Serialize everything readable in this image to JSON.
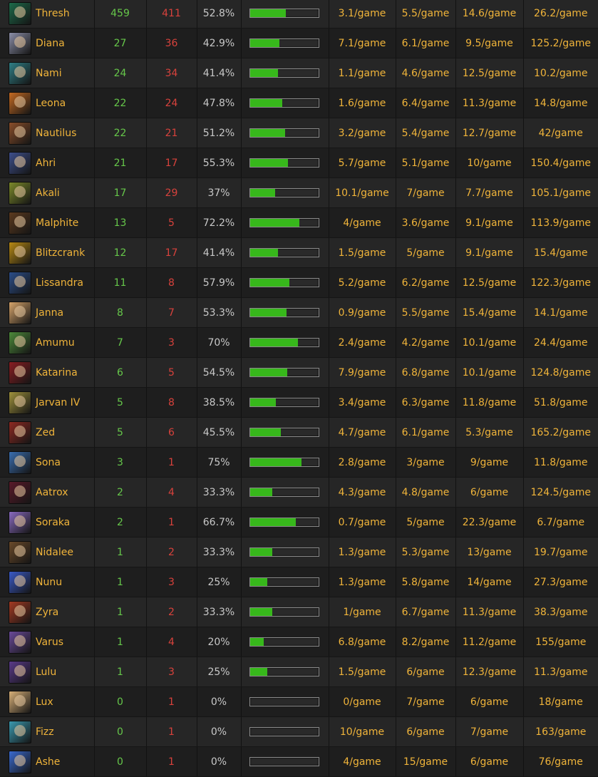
{
  "colors": {
    "champion_name": "#f0b43a",
    "wins": "#66c74a",
    "losses": "#d8423c",
    "win_rate": "#c8c8c8",
    "stats": "#f0b43a",
    "bar_fill": "#37b81b"
  },
  "rows": [
    {
      "name": "Thresh",
      "icon": "thresh-portrait-icon",
      "tint": "#1d6b4a",
      "wins": "459",
      "losses": "411",
      "win_rate": "52.8%",
      "win_fraction": 0.528,
      "s1": "3.1/game",
      "s2": "5.5/game",
      "s3": "14.6/game",
      "s4": "26.2/game"
    },
    {
      "name": "Diana",
      "icon": "diana-portrait-icon",
      "tint": "#8c8fa8",
      "wins": "27",
      "losses": "36",
      "win_rate": "42.9%",
      "win_fraction": 0.429,
      "s1": "7.1/game",
      "s2": "6.1/game",
      "s3": "9.5/game",
      "s4": "125.2/game"
    },
    {
      "name": "Nami",
      "icon": "nami-portrait-icon",
      "tint": "#2f7f86",
      "wins": "24",
      "losses": "34",
      "win_rate": "41.4%",
      "win_fraction": 0.414,
      "s1": "1.1/game",
      "s2": "4.6/game",
      "s3": "12.5/game",
      "s4": "10.2/game"
    },
    {
      "name": "Leona",
      "icon": "leona-portrait-icon",
      "tint": "#c46a22",
      "wins": "22",
      "losses": "24",
      "win_rate": "47.8%",
      "win_fraction": 0.478,
      "s1": "1.6/game",
      "s2": "6.4/game",
      "s3": "11.3/game",
      "s4": "14.8/game"
    },
    {
      "name": "Nautilus",
      "icon": "nautilus-portrait-icon",
      "tint": "#8a4e2a",
      "wins": "22",
      "losses": "21",
      "win_rate": "51.2%",
      "win_fraction": 0.512,
      "s1": "3.2/game",
      "s2": "5.4/game",
      "s3": "12.7/game",
      "s4": "42/game"
    },
    {
      "name": "Ahri",
      "icon": "ahri-portrait-icon",
      "tint": "#3e4f8c",
      "wins": "21",
      "losses": "17",
      "win_rate": "55.3%",
      "win_fraction": 0.553,
      "s1": "5.7/game",
      "s2": "5.1/game",
      "s3": "10/game",
      "s4": "150.4/game"
    },
    {
      "name": "Akali",
      "icon": "akali-portrait-icon",
      "tint": "#7c8a2a",
      "wins": "17",
      "losses": "29",
      "win_rate": "37%",
      "win_fraction": 0.37,
      "s1": "10.1/game",
      "s2": "7/game",
      "s3": "7.7/game",
      "s4": "105.1/game"
    },
    {
      "name": "Malphite",
      "icon": "malphite-portrait-icon",
      "tint": "#5c3a1e",
      "wins": "13",
      "losses": "5",
      "win_rate": "72.2%",
      "win_fraction": 0.722,
      "s1": "4/game",
      "s2": "3.6/game",
      "s3": "9.1/game",
      "s4": "113.9/game"
    },
    {
      "name": "Blitzcrank",
      "icon": "blitzcrank-portrait-icon",
      "tint": "#b88a14",
      "wins": "12",
      "losses": "17",
      "win_rate": "41.4%",
      "win_fraction": 0.414,
      "s1": "1.5/game",
      "s2": "5/game",
      "s3": "9.1/game",
      "s4": "15.4/game"
    },
    {
      "name": "Lissandra",
      "icon": "lissandra-portrait-icon",
      "tint": "#2c4e8a",
      "wins": "11",
      "losses": "8",
      "win_rate": "57.9%",
      "win_fraction": 0.579,
      "s1": "5.2/game",
      "s2": "6.2/game",
      "s3": "12.5/game",
      "s4": "122.3/game"
    },
    {
      "name": "Janna",
      "icon": "janna-portrait-icon",
      "tint": "#d6a46a",
      "wins": "8",
      "losses": "7",
      "win_rate": "53.3%",
      "win_fraction": 0.533,
      "s1": "0.9/game",
      "s2": "5.5/game",
      "s3": "15.4/game",
      "s4": "14.1/game"
    },
    {
      "name": "Amumu",
      "icon": "amumu-portrait-icon",
      "tint": "#4d8a3a",
      "wins": "7",
      "losses": "3",
      "win_rate": "70%",
      "win_fraction": 0.7,
      "s1": "2.4/game",
      "s2": "4.2/game",
      "s3": "10.1/game",
      "s4": "24.4/game"
    },
    {
      "name": "Katarina",
      "icon": "katarina-portrait-icon",
      "tint": "#8a1e22",
      "wins": "6",
      "losses": "5",
      "win_rate": "54.5%",
      "win_fraction": 0.545,
      "s1": "7.9/game",
      "s2": "6.8/game",
      "s3": "10.1/game",
      "s4": "124.8/game"
    },
    {
      "name": "Jarvan IV",
      "icon": "jarvan-iv-portrait-icon",
      "tint": "#a0923c",
      "wins": "5",
      "losses": "8",
      "win_rate": "38.5%",
      "win_fraction": 0.385,
      "s1": "3.4/game",
      "s2": "6.3/game",
      "s3": "11.8/game",
      "s4": "51.8/game"
    },
    {
      "name": "Zed",
      "icon": "zed-portrait-icon",
      "tint": "#8e2a22",
      "wins": "5",
      "losses": "6",
      "win_rate": "45.5%",
      "win_fraction": 0.455,
      "s1": "4.7/game",
      "s2": "6.1/game",
      "s3": "5.3/game",
      "s4": "165.2/game"
    },
    {
      "name": "Sona",
      "icon": "sona-portrait-icon",
      "tint": "#3a6eb0",
      "wins": "3",
      "losses": "1",
      "win_rate": "75%",
      "win_fraction": 0.75,
      "s1": "2.8/game",
      "s2": "3/game",
      "s3": "9/game",
      "s4": "11.8/game"
    },
    {
      "name": "Aatrox",
      "icon": "aatrox-portrait-icon",
      "tint": "#5a1a2a",
      "wins": "2",
      "losses": "4",
      "win_rate": "33.3%",
      "win_fraction": 0.333,
      "s1": "4.3/game",
      "s2": "4.8/game",
      "s3": "6/game",
      "s4": "124.5/game"
    },
    {
      "name": "Soraka",
      "icon": "soraka-portrait-icon",
      "tint": "#8a6ac0",
      "wins": "2",
      "losses": "1",
      "win_rate": "66.7%",
      "win_fraction": 0.667,
      "s1": "0.7/game",
      "s2": "5/game",
      "s3": "22.3/game",
      "s4": "6.7/game"
    },
    {
      "name": "Nidalee",
      "icon": "nidalee-portrait-icon",
      "tint": "#6a4a2a",
      "wins": "1",
      "losses": "2",
      "win_rate": "33.3%",
      "win_fraction": 0.333,
      "s1": "1.3/game",
      "s2": "5.3/game",
      "s3": "13/game",
      "s4": "19.7/game"
    },
    {
      "name": "Nunu",
      "icon": "nunu-portrait-icon",
      "tint": "#3a5ac8",
      "wins": "1",
      "losses": "3",
      "win_rate": "25%",
      "win_fraction": 0.25,
      "s1": "1.3/game",
      "s2": "5.8/game",
      "s3": "14/game",
      "s4": "27.3/game"
    },
    {
      "name": "Zyra",
      "icon": "zyra-portrait-icon",
      "tint": "#a43a22",
      "wins": "1",
      "losses": "2",
      "win_rate": "33.3%",
      "win_fraction": 0.333,
      "s1": "1/game",
      "s2": "6.7/game",
      "s3": "11.3/game",
      "s4": "38.3/game"
    },
    {
      "name": "Varus",
      "icon": "varus-portrait-icon",
      "tint": "#6a4a9a",
      "wins": "1",
      "losses": "4",
      "win_rate": "20%",
      "win_fraction": 0.2,
      "s1": "6.8/game",
      "s2": "8.2/game",
      "s3": "11.2/game",
      "s4": "155/game"
    },
    {
      "name": "Lulu",
      "icon": "lulu-portrait-icon",
      "tint": "#5a3a8a",
      "wins": "1",
      "losses": "3",
      "win_rate": "25%",
      "win_fraction": 0.25,
      "s1": "1.5/game",
      "s2": "6/game",
      "s3": "12.3/game",
      "s4": "11.3/game"
    },
    {
      "name": "Lux",
      "icon": "lux-portrait-icon",
      "tint": "#d8b078",
      "wins": "0",
      "losses": "1",
      "win_rate": "0%",
      "win_fraction": 0,
      "s1": "0/game",
      "s2": "7/game",
      "s3": "6/game",
      "s4": "18/game"
    },
    {
      "name": "Fizz",
      "icon": "fizz-portrait-icon",
      "tint": "#3a9ab0",
      "wins": "0",
      "losses": "1",
      "win_rate": "0%",
      "win_fraction": 0,
      "s1": "10/game",
      "s2": "6/game",
      "s3": "7/game",
      "s4": "163/game"
    },
    {
      "name": "Ashe",
      "icon": "ashe-portrait-icon",
      "tint": "#3a6ad0",
      "wins": "0",
      "losses": "1",
      "win_rate": "0%",
      "win_fraction": 0,
      "s1": "4/game",
      "s2": "15/game",
      "s3": "6/game",
      "s4": "76/game"
    }
  ]
}
